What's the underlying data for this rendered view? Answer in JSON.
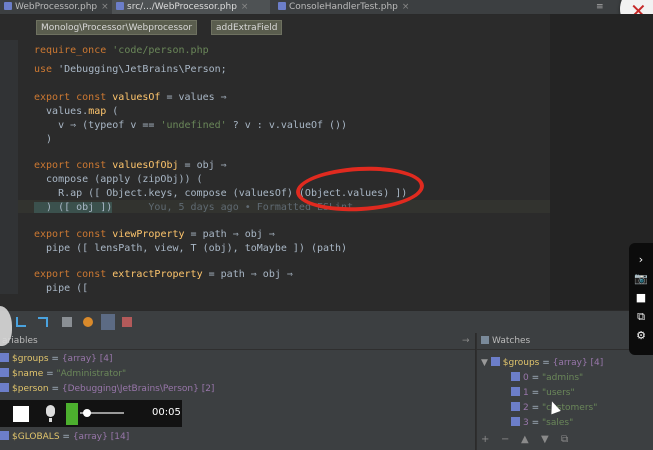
{
  "tabs": [
    {
      "label": "WebProcessor.php",
      "active": false
    },
    {
      "label": "src/.../WebProcessor.php",
      "active": true
    },
    {
      "label": "ConsoleHandlerTest.php",
      "active": false
    }
  ],
  "tab_overflow": "≡",
  "close_glyph": "✕",
  "breadcrumbs": [
    "Monolog\\Processor\\Webprocessor",
    "addExtraField"
  ],
  "code": {
    "require_once": {
      "kw": "require_once",
      "path": "'code/person.php"
    },
    "use": {
      "kw": "use",
      "ns": "'Debugging\\JetBrains\\Person;"
    },
    "l1": {
      "a": "export const ",
      "b": "valuesOf",
      "c": " = values ⇒"
    },
    "l2": {
      "a": "  values.",
      "b": "map",
      "c": " ("
    },
    "l3": {
      "a": "    v ⇒ (typeof v == ",
      "b": "'undefined'",
      "c": " ? v : v.valueOf ())"
    },
    "l4": "  )",
    "l5": {
      "a": "export const ",
      "b": "valuesOfObj",
      "c": " = obj ⇒"
    },
    "l6": {
      "a": "  compose (apply (zipObj)) ("
    },
    "l7": {
      "a": "    R.ap ([ Object.keys, compose (valuesOf) (Object.values) ])"
    },
    "l8": {
      "a": "  ) ([ obj ])",
      "blame": "      You, 5 days ago • Formatted ESLint"
    },
    "l9": {
      "a": "export const ",
      "b": "viewProperty",
      "c": " = path ⇒ obj ⇒"
    },
    "l10": {
      "a": "  pipe ([ lensPath, view, T (obj), toMaybe ]) (path)"
    },
    "l11": {
      "a": "export const ",
      "b": "extractProperty",
      "c": " = path ⇒ obj ⇒"
    },
    "l12": {
      "a": "  pipe (["
    }
  },
  "variables": {
    "header": "ariables",
    "rows": [
      {
        "name": "$groups",
        "eq": " = ",
        "value": "{array} [4]",
        "str": false
      },
      {
        "name": "$name",
        "eq": " = ",
        "value": "\"Administrator\"",
        "str": true
      },
      {
        "name": "$person",
        "eq": " = ",
        "value": "{Debugging\\JetBrains\\Person} [2]",
        "str": false
      },
      {
        "name": "$GLOBALS",
        "eq": " = ",
        "value": "{array} [14]",
        "str": false
      }
    ],
    "corner_glyph": "→"
  },
  "watches": {
    "header": "Watches",
    "root": {
      "name": "$groups",
      "eq": " = ",
      "value": "{array} [4]"
    },
    "items": [
      {
        "index": "0",
        "eq": " = ",
        "value": "\"admins\""
      },
      {
        "index": "1",
        "eq": " = ",
        "value": "\"users\""
      },
      {
        "index": "2",
        "eq": " = ",
        "value": "\"customers\""
      },
      {
        "index": "3",
        "eq": " = ",
        "value": "\"sales\""
      }
    ],
    "toolbar": [
      "+",
      "−",
      "▲",
      "▼",
      "⧉"
    ]
  },
  "recorder": {
    "time": "00:05",
    "level": 0.1
  },
  "sidebar_icons": [
    "›",
    "📷",
    "■",
    "⧉",
    "⚙"
  ],
  "colors": {
    "annotation": "#e02a1f",
    "accent": "#6c7ec9"
  }
}
